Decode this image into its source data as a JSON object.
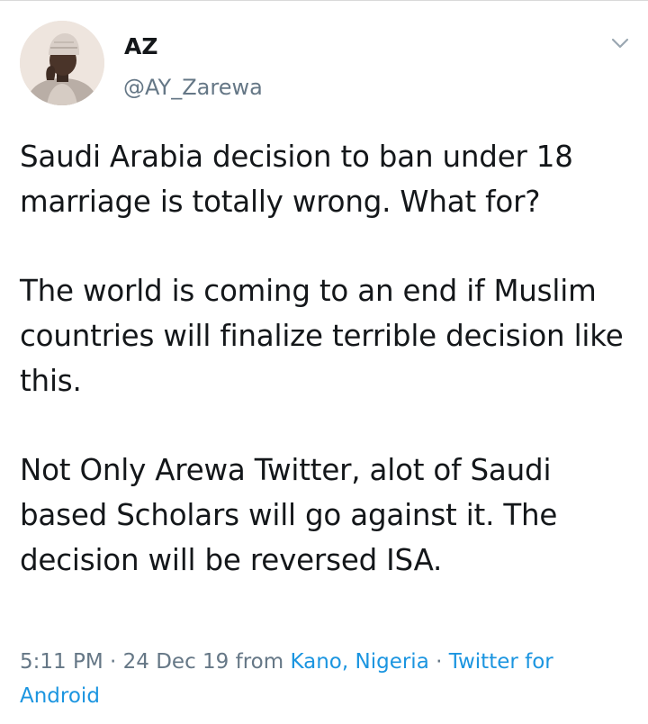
{
  "author": {
    "name": "AZ",
    "handle": "@AY_Zarewa"
  },
  "tweet": {
    "paragraphs": [
      "Saudi Arabia decision to ban under 18 marriage is totally wrong. What for?",
      "The world is coming to an end if Muslim countries will finalize terrible decision like this.",
      "Not Only Arewa Twitter, alot of Saudi based Scholars will go against it. The decision will be reversed ISA."
    ],
    "time": "5:11 PM",
    "sep1": " · ",
    "date": "24 Dec 19",
    "from_label": " from ",
    "location": "Kano, Nigeria",
    "sep2": " · ",
    "client": "Twitter for Android"
  },
  "icons": {
    "menu": "chevron-down-icon"
  },
  "colors": {
    "text": "#14171a",
    "secondary": "#657786",
    "link": "#1b95e0"
  }
}
